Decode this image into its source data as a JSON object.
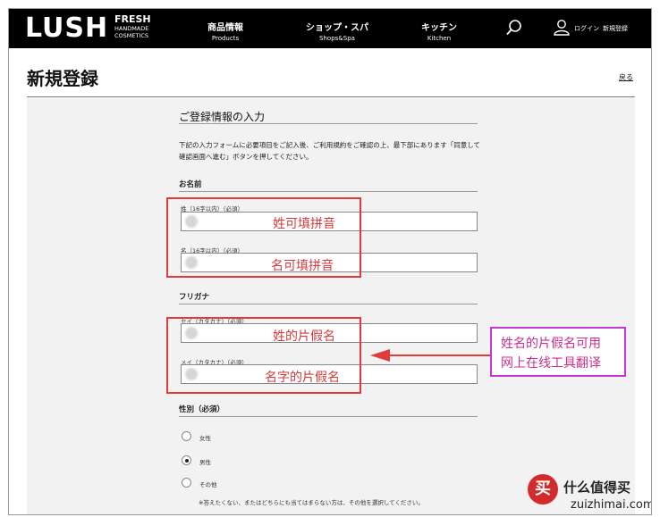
{
  "header": {
    "logo": "LUSH",
    "logo_sub": [
      "FRESH",
      "HANDMADE",
      "COSMETICS"
    ],
    "nav": [
      {
        "jp": "商品情報",
        "en": "Products"
      },
      {
        "jp": "ショップ・スパ",
        "en": "Shops&Spa"
      },
      {
        "jp": "キッチン",
        "en": "Kitchen"
      }
    ],
    "login": "ログイン",
    "register": "新規登録",
    "icons": [
      "search-icon",
      "user-icon"
    ]
  },
  "page": {
    "title": "新規登録",
    "back": "戻る"
  },
  "form": {
    "section_title": "ご登録情報の入力",
    "intro": "下記の入力フォームに必要項目をご記入後、ご利用規約をご確認の上、最下部にあります「同意して確認画面へ進む」ボタンを押してください。",
    "name_group": "お名前",
    "last_name_label": "姓（16字以内）（必須）",
    "first_name_label": "名（16字以内）（必須）",
    "kana_group": "フリガナ",
    "last_kana_label": "セイ（カタカナ）（必須）",
    "first_kana_label": "メイ（カタカナ）（必須）",
    "gender_group": "性別（必須）",
    "gender_options": [
      {
        "label": "女性",
        "selected": false
      },
      {
        "label": "男性",
        "selected": true
      },
      {
        "label": "その他",
        "selected": false
      }
    ],
    "gender_note": "※答えたくない、またはどちらにも当てはまらない方は、その他を選択してください。"
  },
  "annotations": {
    "last_name": "姓可填拼音",
    "first_name": "名可填拼音",
    "last_kana": "姓的片假名",
    "first_kana": "名字的片假名",
    "tip_line1": "姓名的片假名可用",
    "tip_line2": "网上在线工具翻译",
    "box_color": "#e03a3a",
    "tip_color": "#c03ad0"
  },
  "watermark": {
    "badge": "买",
    "brand": "什么值得买",
    "url": "zuizhimai.com"
  }
}
